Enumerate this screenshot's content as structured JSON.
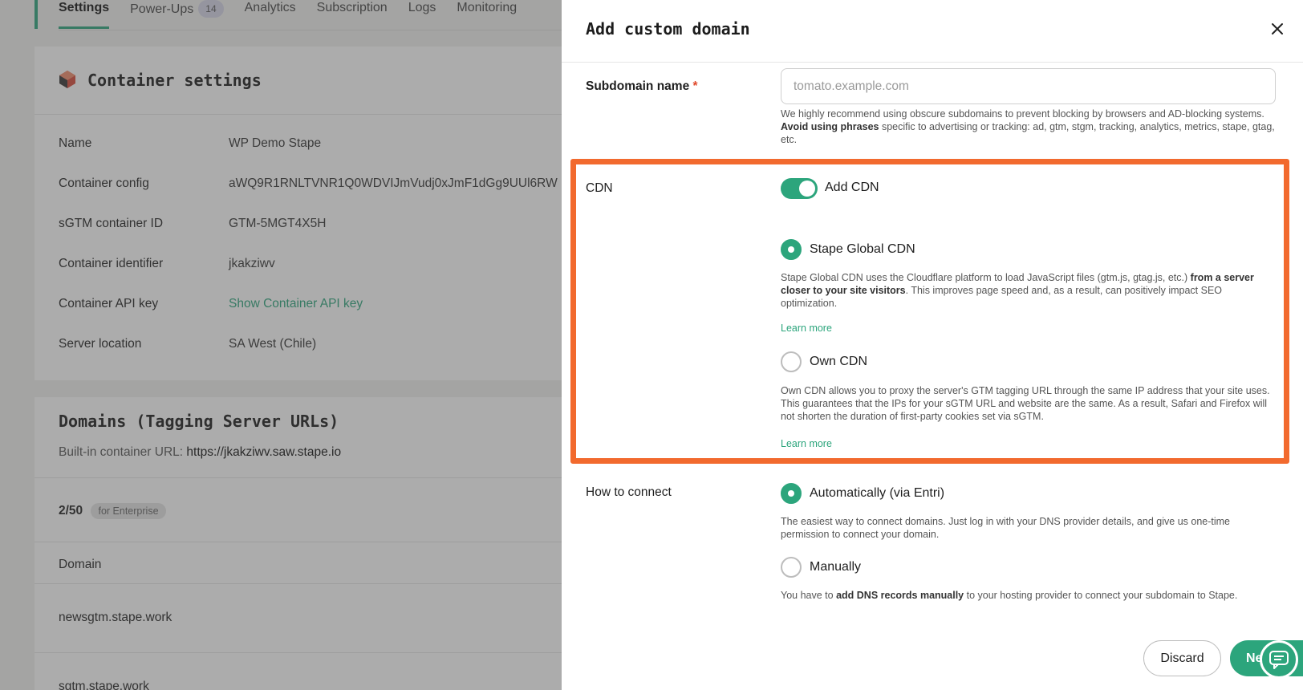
{
  "tabs": [
    {
      "label": "Settings",
      "active": true
    },
    {
      "label": "Power-Ups",
      "badge": "14"
    },
    {
      "label": "Analytics"
    },
    {
      "label": "Subscription"
    },
    {
      "label": "Logs"
    },
    {
      "label": "Monitoring"
    }
  ],
  "container": {
    "title": "Container settings",
    "rows": [
      {
        "label": "Name",
        "value": "WP Demo Stape"
      },
      {
        "label": "Container config",
        "value": "aWQ9R1RNLTVNR1Q0WDVIJmVudj0xJmF1dGg9UUl6RW"
      },
      {
        "label": "sGTM container ID",
        "value": "GTM-5MGT4X5H"
      },
      {
        "label": "Container identifier",
        "value": "jkakziwv"
      },
      {
        "label": "Container API key",
        "value": "Show Container API key"
      },
      {
        "label": "Server location",
        "value": "SA West (Chile)"
      }
    ]
  },
  "domains": {
    "title": "Domains (Tagging Server URLs)",
    "builtin_label": "Built-in container URL:",
    "builtin_url": "https://jkakziwv.saw.stape.io",
    "count": "2/50",
    "plan_badge": "for Enterprise",
    "column": "Domain",
    "items": [
      "newsgtm.stape.work",
      "sgtm.stape.work"
    ]
  },
  "drawer": {
    "title": "Add custom domain",
    "subdomain_label": "Subdomain name",
    "required_mark": "*",
    "subdomain_placeholder": "tomato.example.com",
    "subdomain_help_1": "We highly recommend using obscure subdomains to prevent blocking by browsers and AD-blocking systems.",
    "subdomain_help_bold": "Avoid using phrases",
    "subdomain_help_2": "specific to advertising or tracking: ad, gtm, stgm, tracking, analytics, metrics, stape, gtag, etc.",
    "cdn_label": "CDN",
    "add_cdn_label": "Add CDN",
    "stape_cdn_label": "Stape Global CDN",
    "stape_cdn_help_1": "Stape Global CDN uses the Cloudflare platform to load JavaScript files (gtm.js, gtag.js, etc.)",
    "stape_cdn_help_bold": "from a server closer to your site visitors",
    "stape_cdn_help_2": ". This improves page speed and, as a result, can positively impact SEO optimization.",
    "learn_more": "Learn more",
    "own_cdn_label": "Own CDN",
    "own_cdn_help": "Own CDN allows you to proxy the server's GTM tagging URL through the same IP address that your site uses. This guarantees that the IPs for your sGTM URL and website are the same. As a result, Safari and Firefox will not shorten the duration of first-party cookies set via sGTM.",
    "connect_label": "How to connect",
    "auto_label": "Automatically (via Entri)",
    "auto_help": "The easiest way to connect domains. Just log in with your DNS provider details, and give us one-time permission to connect your domain.",
    "manual_label": "Manually",
    "manual_help_1": "You have to",
    "manual_help_bold": "add DNS records manually",
    "manual_help_2": "to your hosting provider to connect your subdomain to Stape.",
    "discard": "Discard",
    "next": "Ne"
  },
  "colors": {
    "accent": "#2ca57c",
    "highlight": "#f26a2e"
  }
}
